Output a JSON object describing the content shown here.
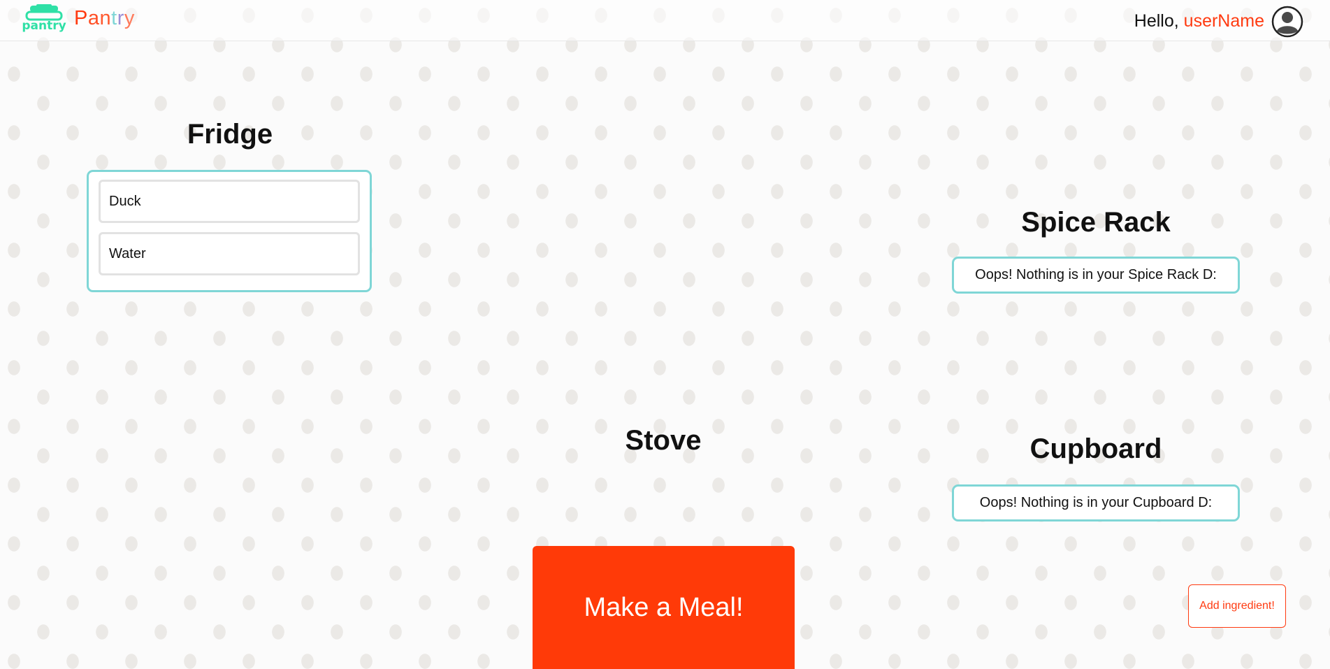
{
  "header": {
    "logo_text": "pantry",
    "brand_letters": [
      {
        "char": "P",
        "color": "#ff3a10"
      },
      {
        "char": "a",
        "color": "#ff4f25"
      },
      {
        "char": "n",
        "color": "#ff5a30"
      },
      {
        "char": "t",
        "color": "#7fd6d6"
      },
      {
        "char": "r",
        "color": "#9b8fd6"
      },
      {
        "char": "y",
        "color": "#ff7a5a"
      }
    ],
    "greeting_prefix": "Hello, ",
    "user_name": "userName",
    "avatar_icon": "user-avatar-icon"
  },
  "fridge": {
    "title": "Fridge",
    "items": [
      "Duck",
      "Water"
    ]
  },
  "spice_rack": {
    "title": "Spice Rack",
    "empty_message": "Oops! Nothing is in your Spice Rack D:"
  },
  "stove": {
    "title": "Stove"
  },
  "cupboard": {
    "title": "Cupboard",
    "empty_message": "Oops! Nothing is in your Cupboard D:"
  },
  "actions": {
    "make_meal_label": "Make a Meal!",
    "add_ingredient_label": "Add ingredient!"
  },
  "colors": {
    "accent": "#ff3a10",
    "teal": "#7fd6d6",
    "logo_green": "#2fe0a6"
  }
}
